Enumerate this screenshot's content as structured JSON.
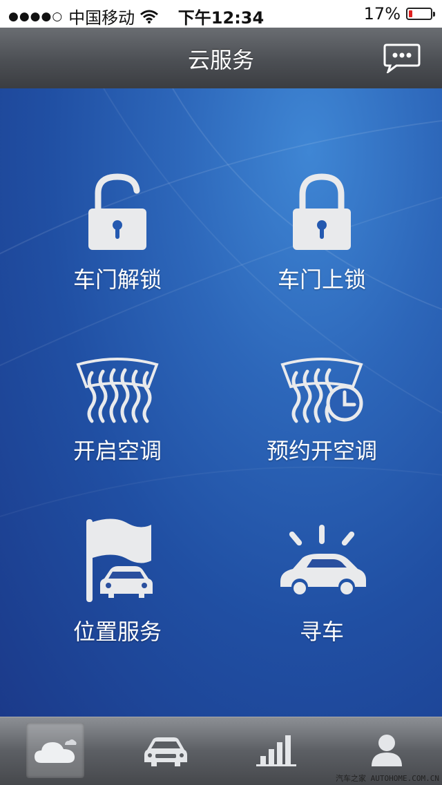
{
  "status_bar": {
    "signal_dots": "●●●●○",
    "carrier": "中国移动",
    "time": "下午12:34",
    "battery_percent": "17%",
    "battery_level": 0.17,
    "battery_color": "#e0201f"
  },
  "navbar": {
    "title": "云服务",
    "message_icon": "chat-bubble-icon"
  },
  "tiles": [
    {
      "label": "车门解锁",
      "icon": "unlock-icon"
    },
    {
      "label": "车门上锁",
      "icon": "lock-icon"
    },
    {
      "label": "开启空调",
      "icon": "defrost-icon"
    },
    {
      "label": "预约开空调",
      "icon": "scheduled-defrost-icon"
    },
    {
      "label": "位置服务",
      "icon": "flag-car-icon"
    },
    {
      "label": "寻车",
      "icon": "car-alarm-icon"
    }
  ],
  "tab_bar": {
    "tabs": [
      {
        "icon": "cloud-icon",
        "active": true
      },
      {
        "icon": "car-icon",
        "active": false
      },
      {
        "icon": "bar-chart-icon",
        "active": false
      },
      {
        "icon": "person-icon",
        "active": false
      }
    ],
    "watermark": "汽车之家 AUTOHOME.COM.CN"
  }
}
